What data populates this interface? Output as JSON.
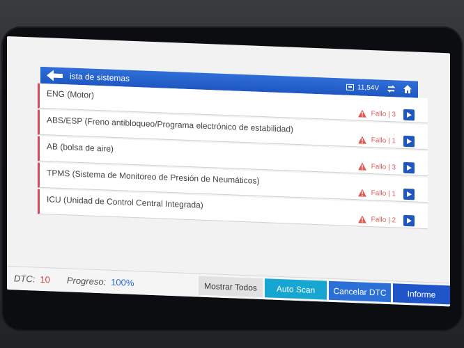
{
  "header": {
    "title": "ista de sistemas",
    "battery_voltage": "11,54V",
    "icons": [
      "back-arrow-icon",
      "battery-icon",
      "reverse-icon",
      "home-icon"
    ]
  },
  "systems": [
    {
      "name": "ENG (Motor)",
      "status": "Fallo | 3"
    },
    {
      "name": "ABS/ESP (Freno antibloqueo/Programa electrónico de estabilidad)",
      "status": "Fallo | 1"
    },
    {
      "name": "AB (bolsa de aire)",
      "status": "Fallo | 3"
    },
    {
      "name": "TPMS (Sistema de Monitoreo de Presión de Neumáticos)",
      "status": "Fallo | 1"
    },
    {
      "name": "ICU (Unidad de Control Central Integrada)",
      "status": "Fallo | 2"
    }
  ],
  "footer": {
    "dtc_label": "DTC:",
    "dtc_value": "10",
    "progress_label": "Progreso:",
    "progress_value": "100%",
    "buttons": {
      "show_all": "Mostrar Todos",
      "auto_scan": "Auto Scan",
      "cancel_dtc": "Cancelar DTC",
      "report": "Informe"
    }
  },
  "colors": {
    "header_blue": "#1f57c2",
    "fault_red": "#e05a56",
    "row_accent": "#d6475a",
    "cyan_button": "#17a6d1",
    "progress_blue": "#2566d7"
  }
}
